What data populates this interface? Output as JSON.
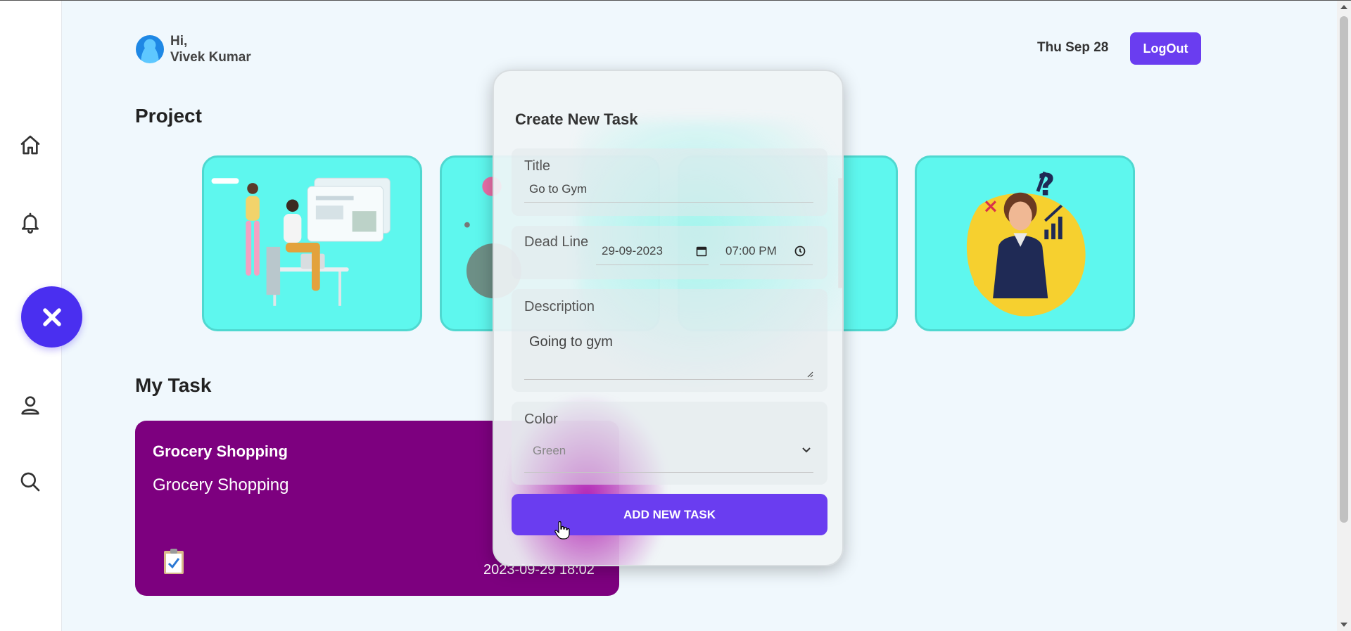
{
  "header": {
    "greeting": "Hi,",
    "user_name": "Vivek Kumar",
    "date": "Thu Sep 28",
    "logout_label": "LogOut"
  },
  "sidebar": {
    "items": [
      {
        "name": "home",
        "icon": "home-icon"
      },
      {
        "name": "notifications",
        "icon": "bell-icon"
      },
      {
        "name": "profile",
        "icon": "user-icon"
      },
      {
        "name": "search",
        "icon": "search-icon"
      }
    ],
    "fab_icon": "close-icon"
  },
  "sections": {
    "project_title": "Project",
    "my_task_title": "My Task"
  },
  "task_card": {
    "title": "Grocery Shopping",
    "description": "Grocery Shopping",
    "datetime": "2023-09-29 18:02",
    "icon": "clipboard-check-icon",
    "color": "#7d007f"
  },
  "modal": {
    "title": "Create New Task",
    "title_label": "Title",
    "title_value": "Go to Gym",
    "deadline_label": "Dead Line",
    "date_value": "29-09-2023",
    "time_value": "07:00 PM",
    "description_label": "Description",
    "description_value": "Going to gym",
    "color_label": "Color",
    "color_value": "Green",
    "add_button": "ADD NEW TASK"
  },
  "colors": {
    "accent": "#6a3df0",
    "fab": "#4a2ff0",
    "card_bg": "#5ef7ee",
    "task_card": "#7d007f"
  }
}
